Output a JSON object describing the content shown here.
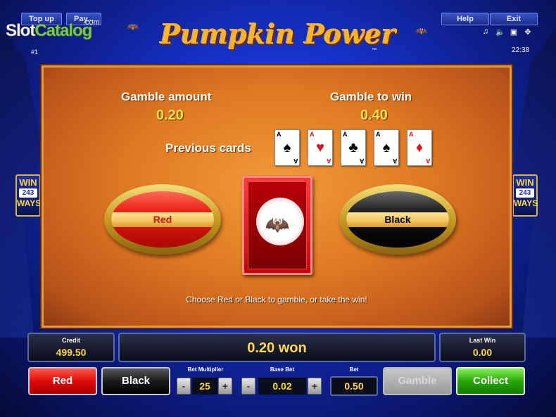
{
  "header": {
    "top_up": "Top up",
    "paytable": "Pay...",
    "help": "Help",
    "exit": "Exit",
    "game_title": "Pumpkin Power",
    "game_no": "#1",
    "clock": "22:38",
    "icons": [
      "music-note-icon",
      "speaker-icon",
      "card-icon",
      "fullscreen-icon"
    ]
  },
  "watermark": {
    "part1": "Slot",
    "part2": "Catalog",
    "suffix": ".com"
  },
  "gamble": {
    "amount_label": "Gamble amount",
    "amount_value": "0.20",
    "to_win_label": "Gamble to win",
    "to_win_value": "0.40",
    "previous_label": "Previous cards",
    "previous_cards": [
      {
        "rank": "A",
        "suit": "♠",
        "color": "black"
      },
      {
        "rank": "A",
        "suit": "♥",
        "color": "red"
      },
      {
        "rank": "A",
        "suit": "♣",
        "color": "black"
      },
      {
        "rank": "A",
        "suit": "♠",
        "color": "black"
      },
      {
        "rank": "A",
        "suit": "♦",
        "color": "red"
      }
    ],
    "red_label": "Red",
    "black_label": "Black",
    "hint": "Choose Red or Black to gamble, or take the win!"
  },
  "badges": {
    "line1": "WIN",
    "line2": "243",
    "line3": "WAYS"
  },
  "console": {
    "credit_label": "Credit",
    "credit_value": "499.50",
    "message": "0.20 won",
    "last_win_label": "Last Win",
    "last_win_value": "0.00",
    "red_button": "Red",
    "black_button": "Black",
    "bet_multiplier_label": "Bet Multiplier",
    "bet_multiplier_value": "25",
    "base_bet_label": "Base Bet",
    "base_bet_value": "0.02",
    "bet_label": "Bet",
    "bet_value": "0.50",
    "gamble_button": "Gamble",
    "collect_button": "Collect",
    "minus": "-",
    "plus": "+"
  },
  "colors": {
    "accent_gold": "#ffd84a",
    "panel_orange": "#e07a22",
    "collect_green": "#2aa80a",
    "red_button": "#e00a0a"
  }
}
